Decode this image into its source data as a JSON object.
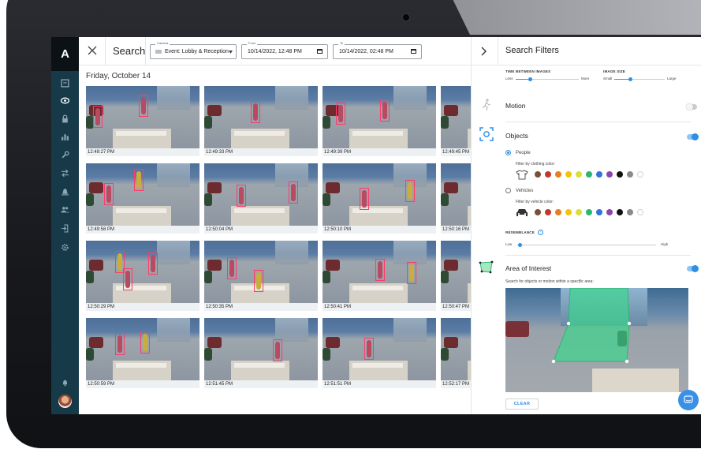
{
  "nav": {
    "logo": "A",
    "items": [
      {
        "icon": "dashboard-icon"
      },
      {
        "icon": "eye-icon"
      },
      {
        "icon": "lock-icon"
      },
      {
        "icon": "bar-chart-icon"
      },
      {
        "icon": "wrench-icon"
      },
      {
        "icon": "transfer-icon"
      },
      {
        "icon": "alarm-icon"
      },
      {
        "icon": "users-icon"
      },
      {
        "icon": "logout-icon"
      },
      {
        "icon": "gear-icon"
      }
    ],
    "bottom": [
      {
        "icon": "bell-icon"
      },
      {
        "icon": "avatar"
      }
    ]
  },
  "search_bar": {
    "title": "Search",
    "camera": {
      "caption": "Camera",
      "value": "Event: Lobby & Reception"
    },
    "from": {
      "caption": "From",
      "value": "10/14/2022, 12:48 PM"
    },
    "to": {
      "caption": "To",
      "value": "10/14/2022, 02:48 PM"
    }
  },
  "results": {
    "date_heading": "Friday, October 14",
    "rows": [
      [
        "12:49:27 PM",
        "12:49:33 PM",
        "12:49:39 PM",
        "12:49:45 PM"
      ],
      [
        "12:49:58 PM",
        "12:50:04 PM",
        "12:50:10 PM",
        "12:50:16 PM"
      ],
      [
        "12:50:29 PM",
        "12:50:35 PM",
        "12:50:41 PM",
        "12:50:47 PM"
      ],
      [
        "12:50:59 PM",
        "12:51:45 PM",
        "12:51:51 PM",
        "12:52:17 PM"
      ]
    ]
  },
  "filters": {
    "title": "Search Filters",
    "time_between": {
      "label": "TIME BETWEEN IMAGES",
      "min": "Less",
      "max": "More",
      "value": 0.2
    },
    "image_size": {
      "label": "IMAGE SIZE",
      "min": "Small",
      "max": "Large",
      "value": 0.25
    },
    "motion": {
      "label": "Motion",
      "enabled": false
    },
    "objects": {
      "label": "Objects",
      "enabled": true,
      "people": {
        "label": "People",
        "selected": true,
        "color_label": "Filter by clothing color:"
      },
      "vehicles": {
        "label": "Vehicles",
        "selected": false,
        "color_label": "Filter by vehicle color:"
      },
      "colors": [
        "#7a4f33",
        "#c0392b",
        "#e67e22",
        "#f1c40f",
        "#d9df3a",
        "#2bb673",
        "#2f74d6",
        "#8e44ad",
        "#111111",
        "#8a8a8a",
        "#ffffff"
      ]
    },
    "resemblance": {
      "label": "RESEMBLANCE",
      "min": "Low",
      "max": "High",
      "value": 0.05
    },
    "area_of_interest": {
      "label": "Area of Interest",
      "enabled": true,
      "help": "Search for objects or motion within a specific area:"
    },
    "clear_label": "CLEAR"
  }
}
